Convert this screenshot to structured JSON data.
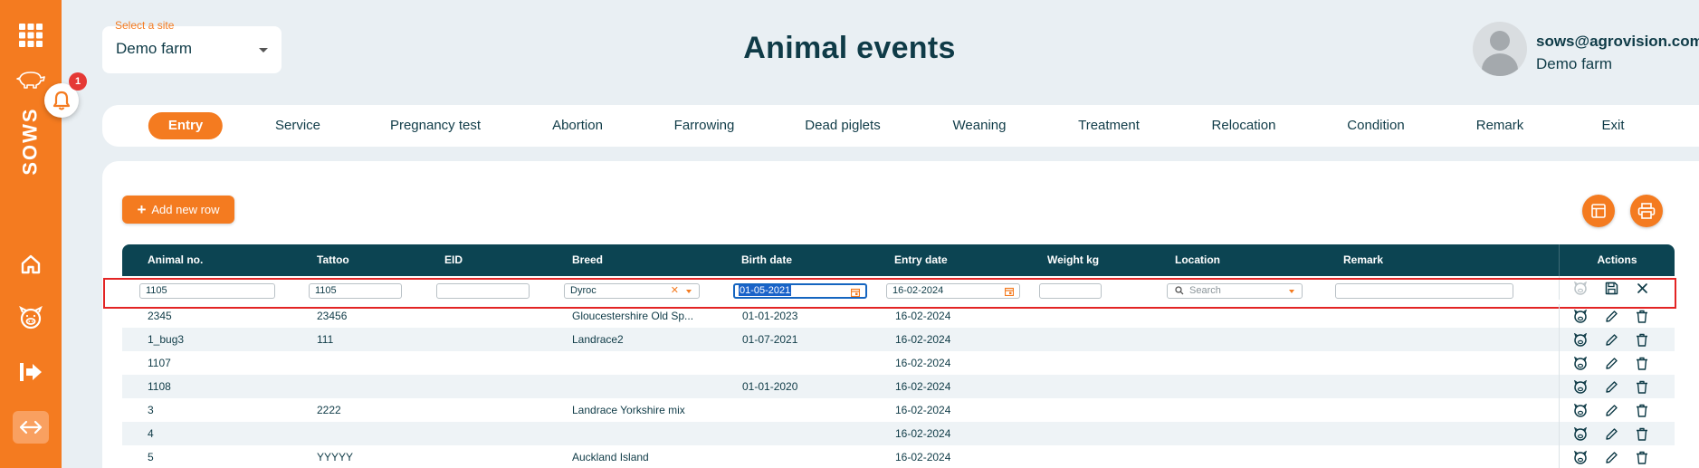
{
  "sidebar": {
    "brand": "SOWS",
    "notification_count": "1"
  },
  "site_selector": {
    "label": "Select a site",
    "value": "Demo farm"
  },
  "page_title": "Animal events",
  "user": {
    "email": "sows@agrovision.com",
    "farm": "Demo farm"
  },
  "tabs": [
    {
      "label": "Entry",
      "active": true
    },
    {
      "label": "Service"
    },
    {
      "label": "Pregnancy test"
    },
    {
      "label": "Abortion"
    },
    {
      "label": "Farrowing"
    },
    {
      "label": "Dead piglets"
    },
    {
      "label": "Weaning"
    },
    {
      "label": "Treatment"
    },
    {
      "label": "Relocation"
    },
    {
      "label": "Condition"
    },
    {
      "label": "Remark"
    },
    {
      "label": "Exit"
    }
  ],
  "toolbar": {
    "add_row_label": "Add new row"
  },
  "table": {
    "columns": [
      "Animal no.",
      "Tattoo",
      "EID",
      "Breed",
      "Birth date",
      "Entry date",
      "Weight kg",
      "Location",
      "Remark"
    ],
    "actions_header": "Actions",
    "edit_row": {
      "animal_no": "1105",
      "tattoo": "1105",
      "eid": "",
      "breed": "Dyroc",
      "birth_date": "01-05-2021",
      "entry_date": "16-02-2024",
      "weight": "",
      "location_placeholder": "Search",
      "remark": ""
    },
    "rows": [
      {
        "animal_no": "2345",
        "tattoo": "23456",
        "eid": "",
        "breed": "Gloucestershire Old Sp...",
        "birth_date": "01-01-2023",
        "entry_date": "16-02-2024",
        "weight": "",
        "location": "",
        "remark": ""
      },
      {
        "animal_no": "1_bug3",
        "tattoo": "111",
        "eid": "",
        "breed": "Landrace2",
        "birth_date": "01-07-2021",
        "entry_date": "16-02-2024",
        "weight": "",
        "location": "",
        "remark": ""
      },
      {
        "animal_no": "1107",
        "tattoo": "",
        "eid": "",
        "breed": "",
        "birth_date": "",
        "entry_date": "16-02-2024",
        "weight": "",
        "location": "",
        "remark": ""
      },
      {
        "animal_no": "1108",
        "tattoo": "",
        "eid": "",
        "breed": "",
        "birth_date": "01-01-2020",
        "entry_date": "16-02-2024",
        "weight": "",
        "location": "",
        "remark": ""
      },
      {
        "animal_no": "3",
        "tattoo": "2222",
        "eid": "",
        "breed": "Landrace Yorkshire mix",
        "birth_date": "",
        "entry_date": "16-02-2024",
        "weight": "",
        "location": "",
        "remark": ""
      },
      {
        "animal_no": "4",
        "tattoo": "",
        "eid": "",
        "breed": "",
        "birth_date": "",
        "entry_date": "16-02-2024",
        "weight": "",
        "location": "",
        "remark": ""
      },
      {
        "animal_no": "5",
        "tattoo": "YYYYY",
        "eid": "",
        "breed": "Auckland Island",
        "birth_date": "",
        "entry_date": "16-02-2024",
        "weight": "",
        "location": "",
        "remark": ""
      }
    ]
  }
}
